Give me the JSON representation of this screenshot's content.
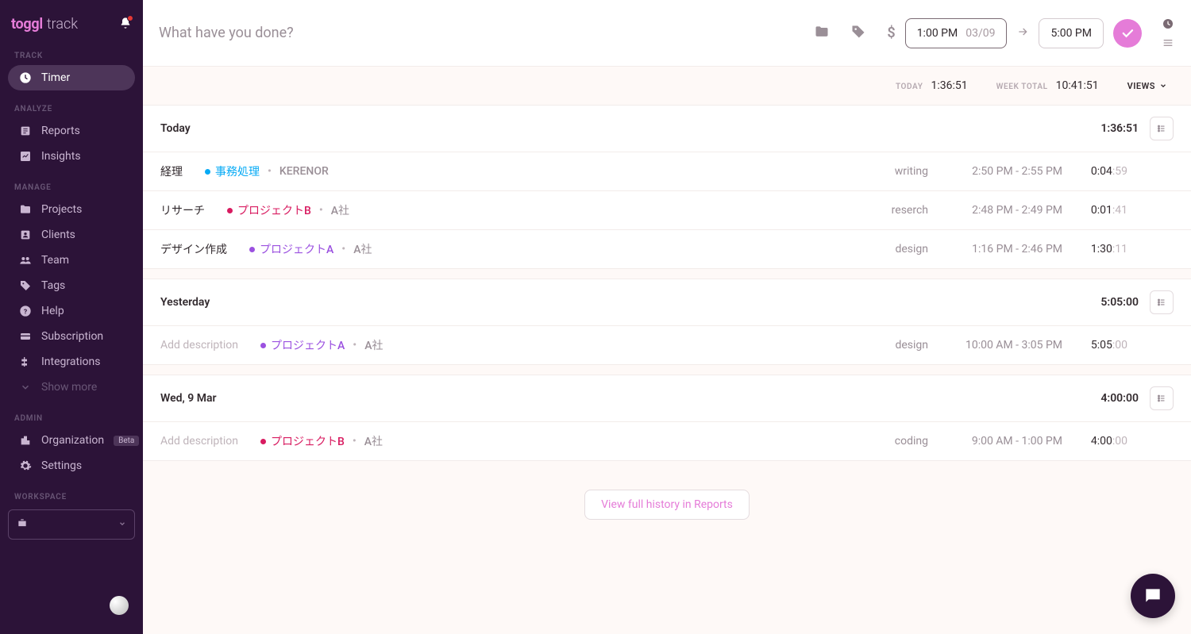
{
  "brand": {
    "name1": "toggl",
    "name2": "track"
  },
  "sidebar": {
    "sections": {
      "track": "TRACK",
      "analyze": "ANALYZE",
      "manage": "MANAGE",
      "admin": "ADMIN",
      "workspace": "WORKSPACE"
    },
    "items": {
      "timer": "Timer",
      "reports": "Reports",
      "insights": "Insights",
      "projects": "Projects",
      "clients": "Clients",
      "team": "Team",
      "tags": "Tags",
      "help": "Help",
      "subscription": "Subscription",
      "integrations": "Integrations",
      "showmore": "Show more",
      "organization": "Organization",
      "org_badge": "Beta",
      "settings": "Settings"
    }
  },
  "timer": {
    "placeholder": "What have you done?",
    "start_time": "1:00 PM",
    "start_date": "03/09",
    "end_time": "5:00 PM"
  },
  "stats": {
    "today_label": "TODAY",
    "today_value": "1:36:51",
    "week_label": "WEEK TOTAL",
    "week_value": "10:41:51",
    "views": "VIEWS"
  },
  "colors": {
    "teal": "#06aaf5",
    "purple": "#9b51e0",
    "pink": "#d81b60"
  },
  "days": [
    {
      "title": "Today",
      "total": "1:36:51",
      "entries": [
        {
          "desc": "経理",
          "desc_placeholder": false,
          "project": "事務処理",
          "project_color": "#06aaf5",
          "client": "KERENOR",
          "tag": "writing",
          "range": "2:50 PM - 2:55 PM",
          "dur_bold": "0:04",
          "dur_faded": ":59"
        },
        {
          "desc": "リサーチ",
          "desc_placeholder": false,
          "project": "プロジェクトB",
          "project_color": "#d81b60",
          "client": "A社",
          "tag": "reserch",
          "range": "2:48 PM - 2:49 PM",
          "dur_bold": "0:01",
          "dur_faded": ":41"
        },
        {
          "desc": "デザイン作成",
          "desc_placeholder": false,
          "project": "プロジェクトA",
          "project_color": "#9b51e0",
          "client": "A社",
          "tag": "design",
          "range": "1:16 PM - 2:46 PM",
          "dur_bold": "1:30",
          "dur_faded": ":11"
        }
      ]
    },
    {
      "title": "Yesterday",
      "total": "5:05:00",
      "entries": [
        {
          "desc": "Add description",
          "desc_placeholder": true,
          "project": "プロジェクトA",
          "project_color": "#9b51e0",
          "client": "A社",
          "tag": "design",
          "range": "10:00 AM - 3:05 PM",
          "dur_bold": "5:05",
          "dur_faded": ":00"
        }
      ]
    },
    {
      "title": "Wed, 9 Mar",
      "total": "4:00:00",
      "entries": [
        {
          "desc": "Add description",
          "desc_placeholder": true,
          "project": "プロジェクトB",
          "project_color": "#d81b60",
          "client": "A社",
          "tag": "coding",
          "range": "9:00 AM - 1:00 PM",
          "dur_bold": "4:00",
          "dur_faded": ":00"
        }
      ]
    }
  ],
  "footer": {
    "link": "View full history in Reports"
  }
}
